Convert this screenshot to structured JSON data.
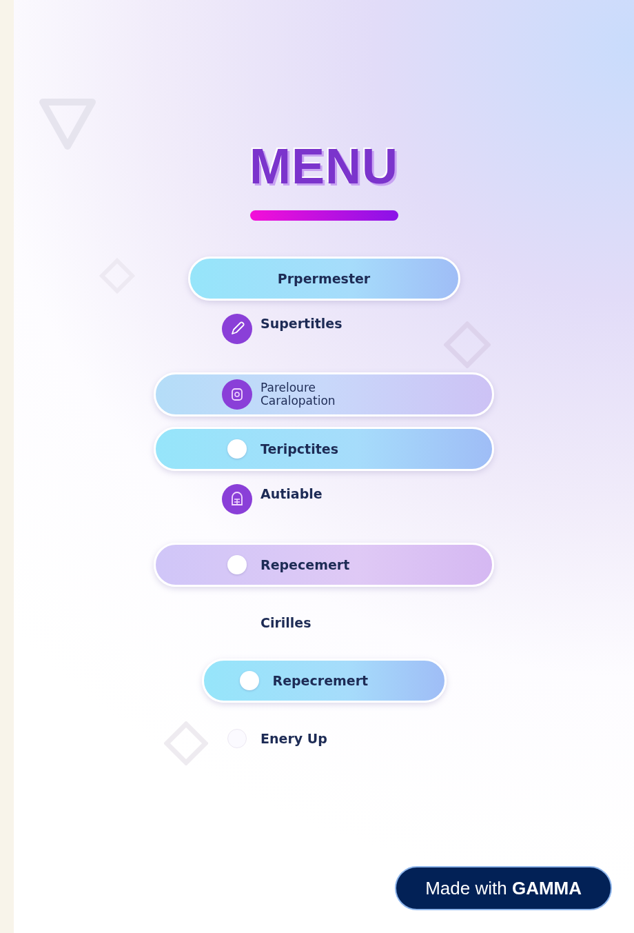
{
  "title": "MENU",
  "items": [
    {
      "kind": "pill",
      "label": "Prpermester"
    },
    {
      "kind": "plain",
      "label": "Supertitles"
    },
    {
      "kind": "pill",
      "label": "Pareloure Caralopation"
    },
    {
      "kind": "pill",
      "label": "Teripctites"
    },
    {
      "kind": "plain",
      "label": "Autiable"
    },
    {
      "kind": "pill",
      "label": "Repecemert"
    },
    {
      "kind": "plain",
      "label": "Cirilles"
    },
    {
      "kind": "pill",
      "label": "Repecremert"
    },
    {
      "kind": "plain",
      "label": "Enery Up"
    }
  ],
  "badge": {
    "label": "Made with **GAMMA**"
  }
}
